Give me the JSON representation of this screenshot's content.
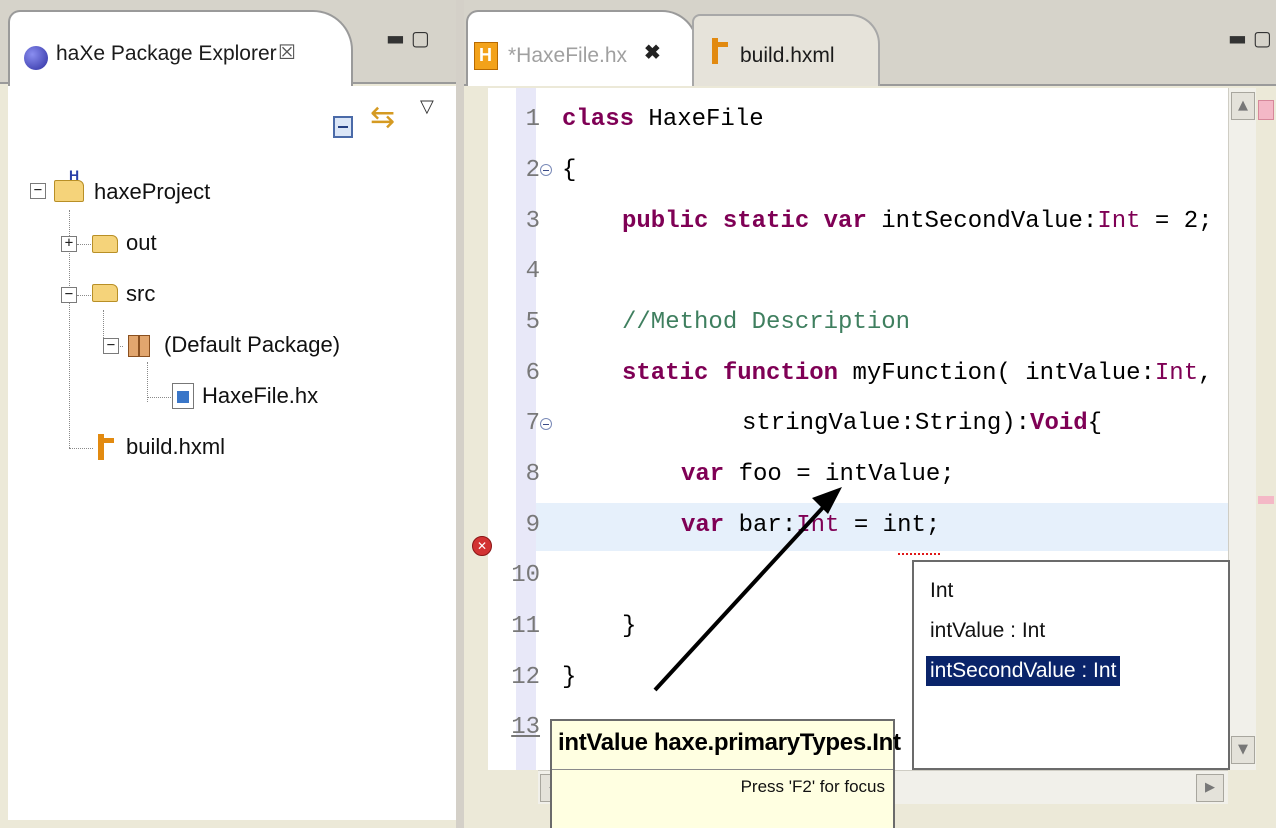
{
  "explorer": {
    "tab_title": "haXe Package Explorer",
    "tree": [
      {
        "label": "haxeProject"
      },
      {
        "label": "out"
      },
      {
        "label": "src"
      },
      {
        "label": "(Default Package)"
      },
      {
        "label": "HaxeFile.hx"
      },
      {
        "label": "build.hxml"
      }
    ]
  },
  "editor": {
    "tabs": [
      {
        "label": "*HaxeFile.hx",
        "dirty": true,
        "active": true
      },
      {
        "label": "build.hxml",
        "active": false
      }
    ],
    "line_numbers": [
      "1",
      "2",
      "3",
      "4",
      "5",
      "6",
      "7",
      "8",
      "9",
      "10",
      "11",
      "12",
      "13"
    ],
    "code": {
      "l1_kw": "class",
      "l1_name": " HaxeFile",
      "l2": "{",
      "l3_kw1": "public",
      "l3_kw2": "static",
      "l3_kw3": "var",
      "l3_name": " intSecondValue:",
      "l3_type": "Int",
      "l3_rest": " = 2;",
      "l5_comment": "//Method Description",
      "l6_kw1": "static",
      "l6_kw2": "function",
      "l6_name": " myFunction( intValue:",
      "l6_type": "Int",
      "l6_rest": ",",
      "l7_text": "stringValue:String):",
      "l7_kw": "Void",
      "l7_rest": "{",
      "l8_kw": "var",
      "l8_rest": " foo = intValue;",
      "l9_kw": "var",
      "l9_name": " bar:",
      "l9_type": "Int",
      "l9_rest": " = int;",
      "l11": "}",
      "l12": "}"
    },
    "error_line": 9,
    "current_line": 13
  },
  "tooltip": {
    "title": "intValue haxe.primaryTypes.Int",
    "hint": "Press 'F2' for focus"
  },
  "completion": {
    "items": [
      {
        "label": "Int"
      },
      {
        "label": "intValue : Int"
      },
      {
        "label": "intSecondValue : Int"
      }
    ],
    "selected_index": 2
  },
  "colors": {
    "keyword": "#7f0055",
    "comment": "#3f7f5f",
    "selection": "#0a246a",
    "tooltip_bg": "#ffffe1",
    "highlight_line": "#e6f0fb"
  }
}
